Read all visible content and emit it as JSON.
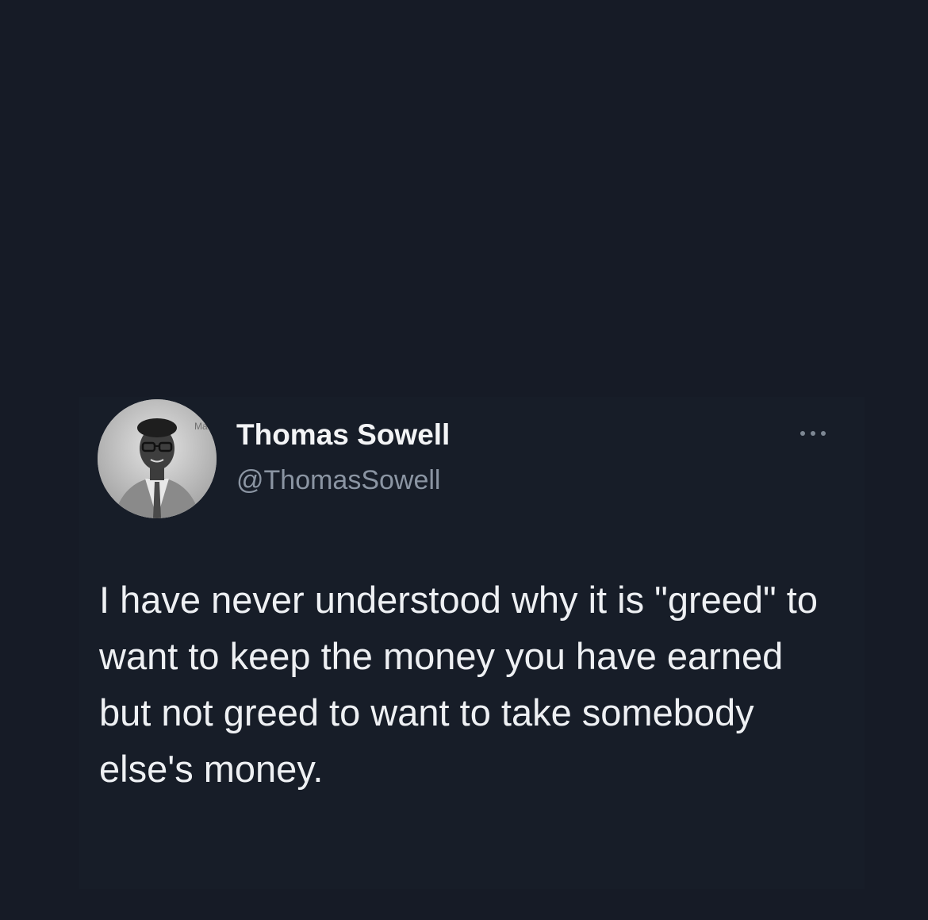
{
  "colors": {
    "background": "#161b26",
    "name_text": "#f3f4f6",
    "handle_text": "#8b95a3",
    "body_text": "#eef0f3"
  },
  "tweet": {
    "display_name": "Thomas Sowell",
    "handle": "@ThomasSowell",
    "avatar_icon": "profile-photo",
    "more_icon": "ellipsis-icon",
    "text": "I have never understood why it is \"greed\" to want to keep the money you have earned but not greed to want to take somebody else's money."
  }
}
